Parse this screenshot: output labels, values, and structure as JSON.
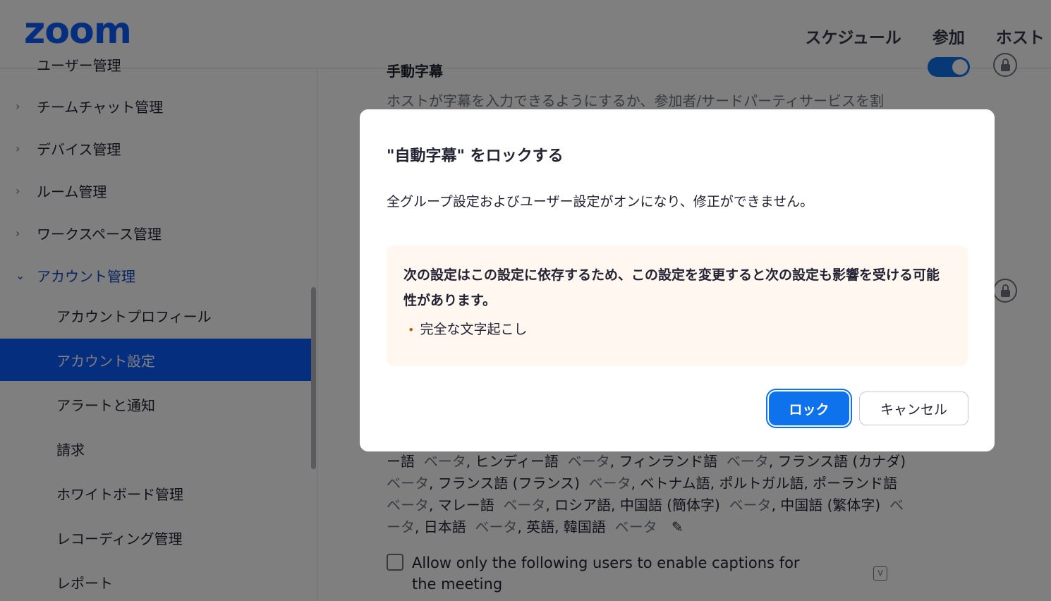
{
  "header": {
    "logo": "zoom",
    "nav": [
      "スケジュール",
      "参加",
      "ホスト"
    ]
  },
  "sidebar": {
    "cut_item": "ユーザー管理",
    "items": [
      {
        "label": "チームチャット管理",
        "chevron": "›"
      },
      {
        "label": "デバイス管理",
        "chevron": "›"
      },
      {
        "label": "ルーム管理",
        "chevron": "›"
      },
      {
        "label": "ワークスペース管理",
        "chevron": "›"
      },
      {
        "label": "アカウント管理",
        "chevron": "⌄"
      }
    ],
    "sub_items": [
      "アカウントプロフィール",
      "アカウント設定",
      "アラートと通知",
      "請求",
      "ホワイトボード管理",
      "レコーディング管理",
      "レポート"
    ]
  },
  "main": {
    "cut_title": "手動字幕",
    "description": "ホストが字幕を入力できるようにするか、参加者/サードパーティサービスを割",
    "languages": {
      "line1": [
        "ー語",
        "ベータ",
        ", ヒンディー語",
        "ベータ",
        ", フィンランド語",
        "ベータ",
        ", フランス語 (カナダ)"
      ],
      "line2": [
        "ベータ",
        ", フランス語 (フランス)",
        "ベータ",
        ", ベトナム語, ポルトガル語, ポーランド語"
      ],
      "line3": [
        "ベータ",
        ", マレー語",
        "ベータ",
        ", ロシア語, 中国語 (簡体字)",
        "ベータ",
        ", 中国語 (繁体字)",
        "ベ"
      ],
      "line4": [
        "ータ",
        ", 日本語",
        "ベータ",
        ", 英語, 韓国語",
        "ベータ"
      ]
    },
    "checkbox_label": "Allow only the following users to enable captions for the meeting",
    "toggle_on": true
  },
  "dialog": {
    "title": "\"自動字幕\" をロックする",
    "message": "全グループ設定およびユーザー設定がオンになり、修正ができません。",
    "warning": "次の設定はこの設定に依存するため、この設定を変更すると次の設定も影響を受ける可能性があります。",
    "dependent_item": "完全な文字起こし",
    "lock_button": "ロック",
    "cancel_button": "キャンセル"
  },
  "colors": {
    "brand": "#0b5cff",
    "primary_button": "#0e72ed",
    "warning_bg": "#fff7f0"
  }
}
